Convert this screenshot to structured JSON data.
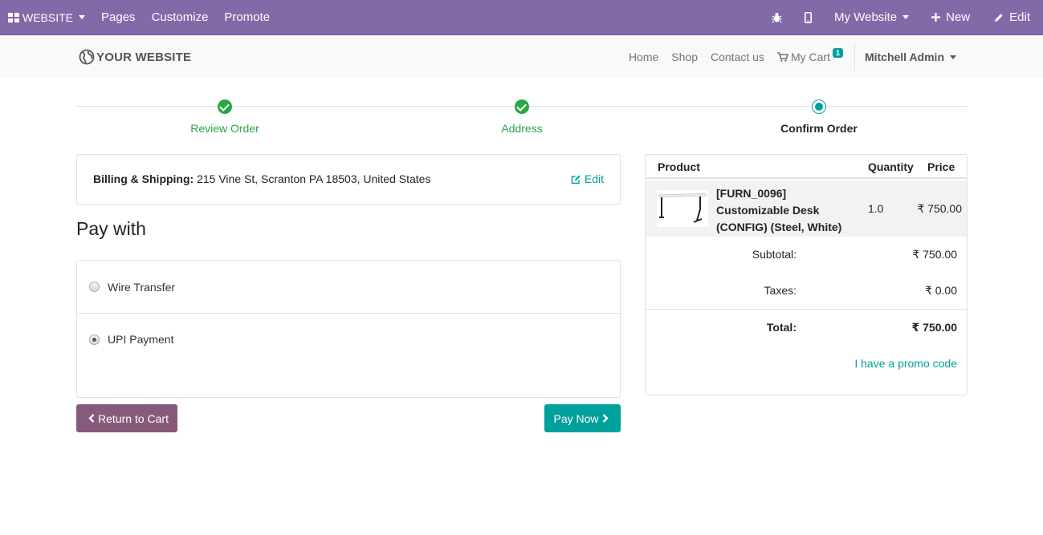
{
  "adminbar": {
    "website": "WEBSITE",
    "pages": "Pages",
    "customize": "Customize",
    "promote": "Promote",
    "my_website": "My Website",
    "new": "New",
    "edit": "Edit"
  },
  "header": {
    "logo": "YOUR WEBSITE",
    "nav": {
      "home": "Home",
      "shop": "Shop",
      "contact": "Contact us",
      "cart": "My Cart",
      "cart_count": "1",
      "user": "Mitchell Admin"
    }
  },
  "steps": [
    {
      "label": "Review Order",
      "state": "done"
    },
    {
      "label": "Address",
      "state": "done"
    },
    {
      "label": "Confirm Order",
      "state": "current"
    }
  ],
  "billing": {
    "label": "Billing & Shipping:",
    "address": "215 Vine St, Scranton PA 18503, United States",
    "edit": "Edit"
  },
  "pay_with": "Pay with",
  "payment_methods": [
    {
      "label": "Wire Transfer",
      "selected": false
    },
    {
      "label": "UPI Payment",
      "selected": true
    }
  ],
  "buttons": {
    "return": "Return to Cart",
    "pay": "Pay Now"
  },
  "summary": {
    "headers": {
      "product": "Product",
      "quantity": "Quantity",
      "price": "Price"
    },
    "item": {
      "name": "[FURN_0096] Customizable Desk (CONFIG) (Steel, White)",
      "quantity": "1.0",
      "price": "₹ 750.00"
    },
    "subtotal_label": "Subtotal:",
    "subtotal": "₹ 750.00",
    "taxes_label": "Taxes:",
    "taxes": "₹ 0.00",
    "total_label": "Total:",
    "total": "₹ 750.00",
    "promo": "I have a promo code"
  },
  "colors": {
    "adminbar": "#8269a8",
    "primary": "#00a09d",
    "secondary": "#875a7b",
    "success": "#28a745"
  }
}
